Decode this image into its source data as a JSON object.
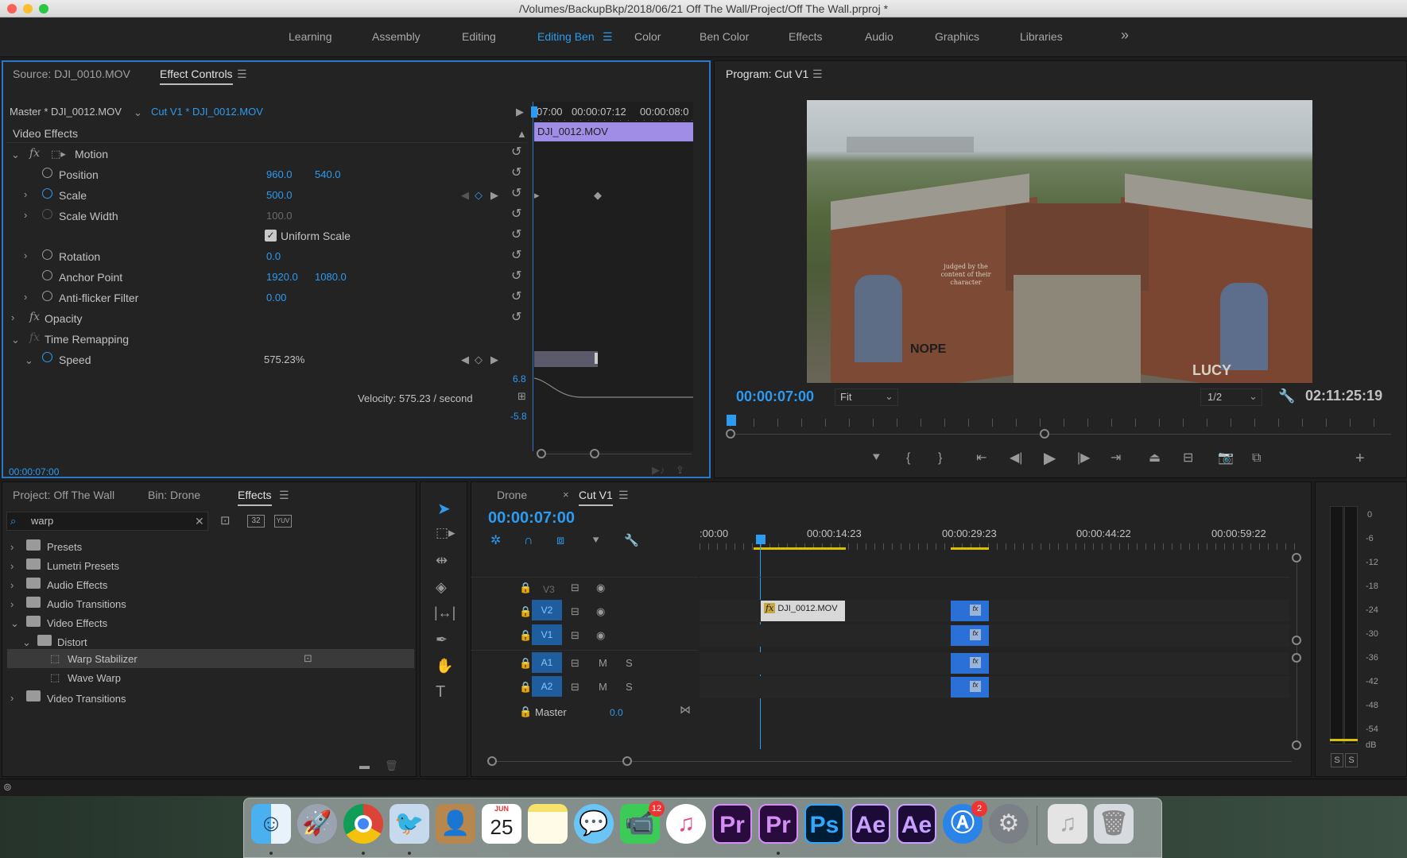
{
  "window": {
    "title": "/Volumes/BackupBkp/2018/06/21 Off The Wall/Project/Off The Wall.prproj *"
  },
  "workspaces": [
    {
      "label": "Learning"
    },
    {
      "label": "Assembly"
    },
    {
      "label": "Editing"
    },
    {
      "label": "Editing Ben"
    },
    {
      "label": "Color"
    },
    {
      "label": "Ben Color"
    },
    {
      "label": "Effects"
    },
    {
      "label": "Audio"
    },
    {
      "label": "Graphics"
    },
    {
      "label": "Libraries"
    }
  ],
  "workspace_more": "»",
  "effect_controls": {
    "tab_source": "Source: DJI_0010.MOV",
    "tab_active": "Effect Controls",
    "master_clip": "Master * DJI_0012.MOV",
    "sequence_clip": "Cut V1 * DJI_0012.MOV",
    "timecodes": [
      "07:00",
      "00:00:07:12",
      "00:00:08:0"
    ],
    "clip_bar": "DJI_0012.MOV",
    "section": "Video Effects",
    "motion": "Motion",
    "position_label": "Position",
    "position_x": "960.0",
    "position_y": "540.0",
    "scale_label": "Scale",
    "scale_val": "500.0",
    "scale_width_label": "Scale Width",
    "scale_width_val": "100.0",
    "uniform_scale": "Uniform Scale",
    "rotation_label": "Rotation",
    "rotation_val": "0.0",
    "anchor_label": "Anchor Point",
    "anchor_x": "1920.0",
    "anchor_y": "1080.0",
    "antiflicker_label": "Anti-flicker Filter",
    "antiflicker_val": "0.00",
    "opacity": "Opacity",
    "time_remap": "Time Remapping",
    "speed_label": "Speed",
    "speed_val": "575.23%",
    "graph_max": "6.8",
    "graph_min": "-5.8",
    "velocity": "Velocity: 575.23 / second",
    "current_time": "00:00:07:00",
    "fx": "fx"
  },
  "program": {
    "title": "Program: Cut V1",
    "timecode": "00:00:07:00",
    "fit": "Fit",
    "resolution": "1/2",
    "duration": "02:11:25:19",
    "mural_text": "judged by the content of their character",
    "mural_nope": "NOPE",
    "mural_lucy": "LUCY"
  },
  "project": {
    "tab_project": "Project: Off The Wall",
    "tab_bin": "Bin: Drone",
    "tab_effects": "Effects",
    "search_value": "warp",
    "badge_32": "32",
    "badge_yuv": "YUV",
    "tree": [
      {
        "label": "Presets"
      },
      {
        "label": "Lumetri Presets"
      },
      {
        "label": "Audio Effects"
      },
      {
        "label": "Audio Transitions"
      },
      {
        "label": "Video Effects"
      },
      {
        "label": "Distort"
      },
      {
        "label": "Warp Stabilizer"
      },
      {
        "label": "Wave Warp"
      },
      {
        "label": "Video Transitions"
      }
    ]
  },
  "timeline": {
    "tab_drone": "Drone",
    "tab_cut": "Cut V1",
    "timecode": "00:00:07:00",
    "ruler": [
      ":00:00",
      "00:00:14:23",
      "00:00:29:23",
      "00:00:44:22",
      "00:00:59:22"
    ],
    "tracks": [
      {
        "name": "V3"
      },
      {
        "name": "V2"
      },
      {
        "name": "V1"
      },
      {
        "name": "A1"
      },
      {
        "name": "A2"
      }
    ],
    "mute": "M",
    "solo": "S",
    "master_label": "Master",
    "master_val": "0.0",
    "clip_name": "DJI_0012.MOV",
    "fx": "fx"
  },
  "meter": {
    "labels": [
      "0",
      "-6",
      "-12",
      "-18",
      "-24",
      "-30",
      "-36",
      "-42",
      "-48",
      "-54",
      "dB"
    ],
    "solo_left": "S",
    "solo_right": "S"
  },
  "dock": {
    "calendar_month": "JUN",
    "calendar_day": "25",
    "facetime_badge": "12",
    "appstore_badge": "2",
    "premiere": "Pr",
    "photoshop": "Ps",
    "after_effects": "Ae"
  },
  "colors": {
    "accent": "#2d9bf0",
    "clip_purple": "#a08ee6",
    "panel": "#232323",
    "selection": "#1f5e9e"
  }
}
